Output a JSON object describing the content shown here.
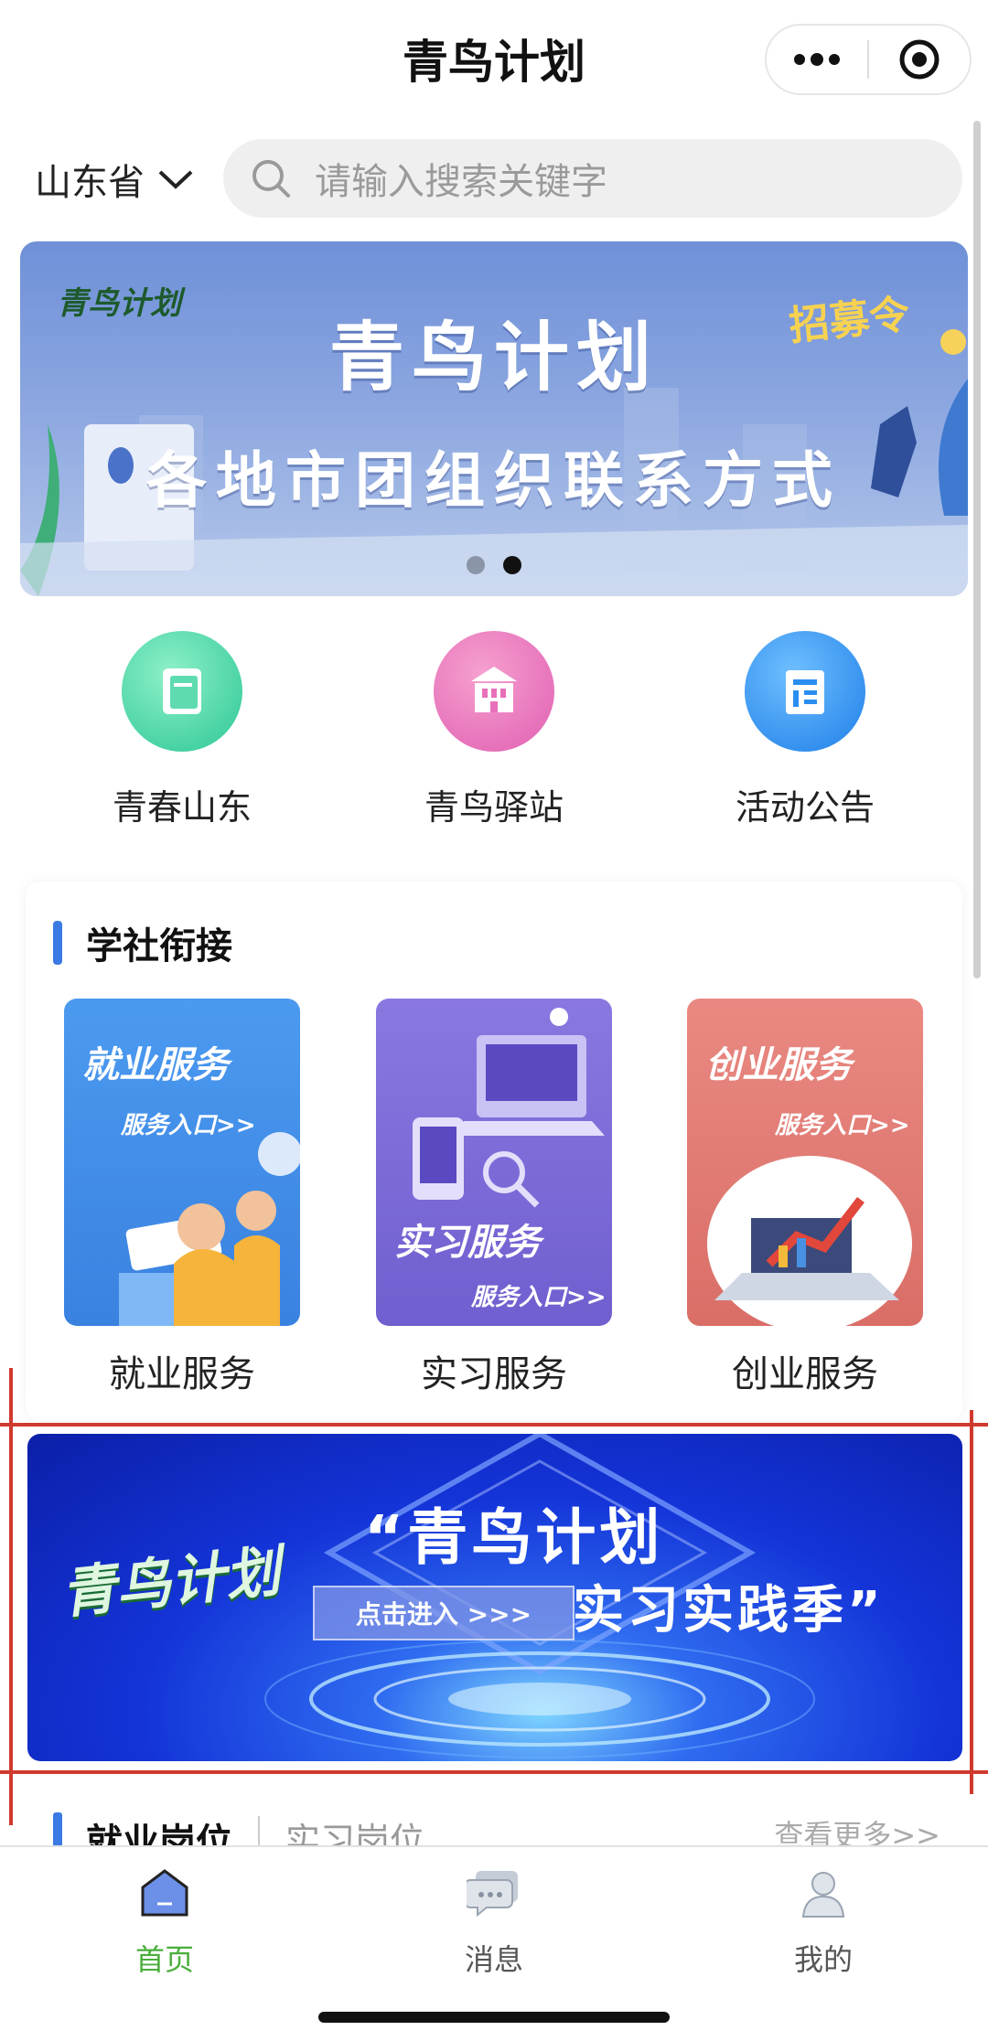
{
  "titlebar": {
    "title": "青鸟计划"
  },
  "search": {
    "province": "山东省",
    "placeholder": "请输入搜索关键字"
  },
  "banner": {
    "title": "青鸟计划",
    "subtitle": "各地市团组织联系方式",
    "tag": "招募令",
    "logo_text": "青鸟计划",
    "slide_count": 2,
    "active_slide": 2
  },
  "quick_links": [
    {
      "label": "青春山东",
      "icon": "book-icon",
      "color": "#43d3a0"
    },
    {
      "label": "青鸟驿站",
      "icon": "building-icon",
      "color": "#e65fb2"
    },
    {
      "label": "活动公告",
      "icon": "notice-icon",
      "color": "#2a8ef0"
    }
  ],
  "section": {
    "title": "学社衔接",
    "services": [
      {
        "card_title": "就业服务",
        "card_sub": "服务入口>>",
        "label": "就业服务",
        "color": "#3f8de8"
      },
      {
        "card_title": "实习服务",
        "card_sub": "服务入口>>",
        "label": "实习服务",
        "color": "#7b68d6"
      },
      {
        "card_title": "创业服务",
        "card_sub": "服务入口>>",
        "label": "创业服务",
        "color": "#e07a72"
      }
    ]
  },
  "promo": {
    "logo_text": "青鸟计划",
    "title": "“青鸟计划",
    "button": "点击进入 >>>",
    "subtitle": "实习实践季”"
  },
  "jobs": {
    "tab_active": "就业岗位",
    "tab_other": "实习岗位",
    "more": "查看更多>>"
  },
  "tabbar": [
    {
      "label": "首页",
      "icon": "home-icon",
      "active": true
    },
    {
      "label": "消息",
      "icon": "message-icon",
      "active": false
    },
    {
      "label": "我的",
      "icon": "profile-icon",
      "active": false
    }
  ],
  "colors": {
    "accent_blue": "#3b7ae5",
    "tab_active": "#4aae3b",
    "annotation_red": "#d03a2e"
  }
}
